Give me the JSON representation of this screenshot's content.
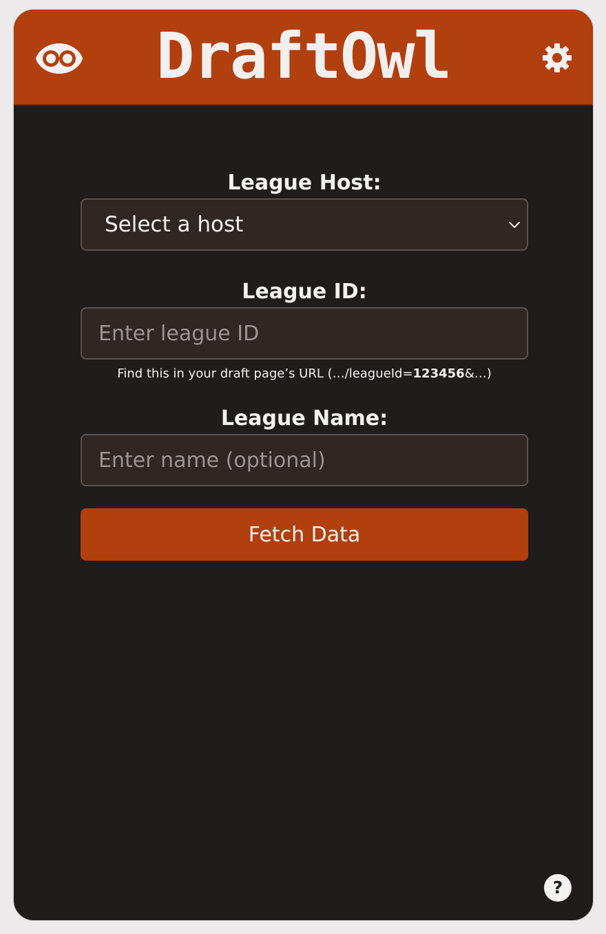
{
  "app": {
    "title": "DraftOwl"
  },
  "header": {
    "left_icon": "eye-icon",
    "right_icon": "gear-icon"
  },
  "form": {
    "host_label": "League Host:",
    "host_select_value": "Select a host",
    "league_id_label": "League ID:",
    "league_id_placeholder": "Enter league ID",
    "league_id_hint_prefix": "Find this in your draft page’s URL (…/leagueId=",
    "league_id_hint_example": "123456",
    "league_id_hint_suffix": "&…)",
    "league_name_label": "League Name:",
    "league_name_placeholder": "Enter name (optional)",
    "fetch_button_label": "Fetch Data"
  },
  "footer": {
    "help_label": "?"
  },
  "colors": {
    "brand": "#b23f0e",
    "background": "#201c1b",
    "field": "#302725",
    "text": "#f3f1f1"
  }
}
